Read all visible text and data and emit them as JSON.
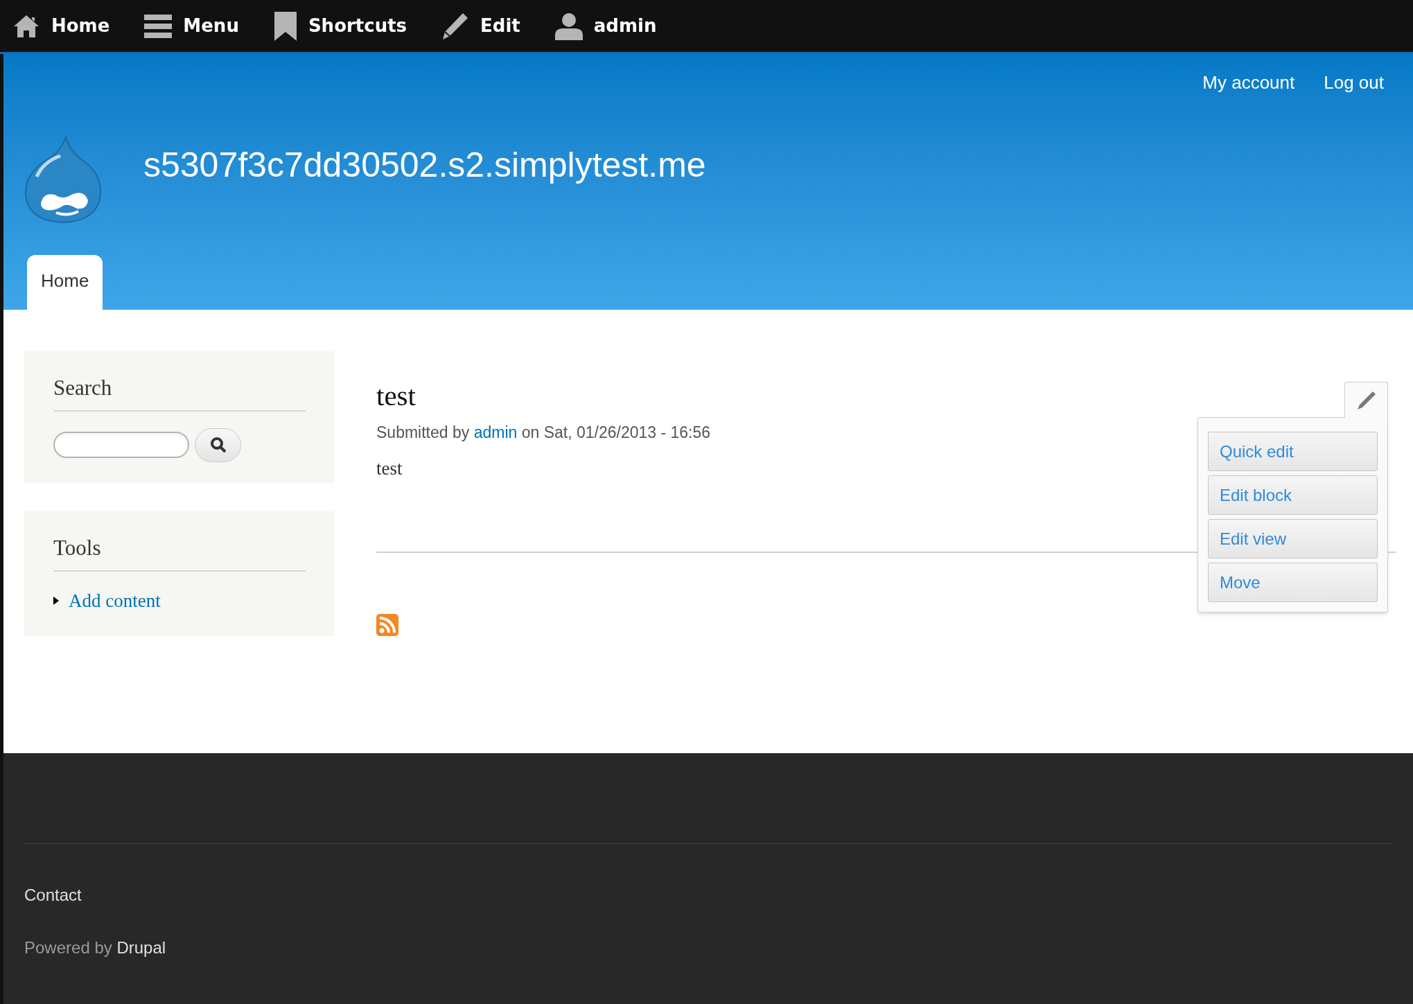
{
  "toolbar": {
    "items": [
      {
        "kind": "home",
        "label": "Home"
      },
      {
        "kind": "menu",
        "label": "Menu"
      },
      {
        "kind": "shortcuts",
        "label": "Shortcuts"
      },
      {
        "kind": "edit",
        "label": "Edit"
      },
      {
        "kind": "user",
        "label": "admin"
      }
    ]
  },
  "header": {
    "account_links": [
      "My account",
      "Log out"
    ],
    "site_name": "s5307f3c7dd30502.s2.simplytest.me",
    "tabs": [
      {
        "label": "Home",
        "selected": true
      }
    ]
  },
  "sidebar": {
    "search": {
      "title": "Search"
    },
    "tools": {
      "title": "Tools",
      "links": [
        "Add content"
      ]
    }
  },
  "node": {
    "title": "test",
    "submitted": {
      "prefix": "Submitted by",
      "author": "admin",
      "suffix": "on Sat, 01/26/2013 - 16:56"
    },
    "body": "test"
  },
  "contextual": {
    "expanded": true,
    "links": [
      "Quick edit",
      "Edit block",
      "Edit view",
      "Move"
    ]
  },
  "footer": {
    "links": [
      "Contact"
    ],
    "powered": {
      "prefix": "Powered by",
      "link": "Drupal"
    }
  }
}
